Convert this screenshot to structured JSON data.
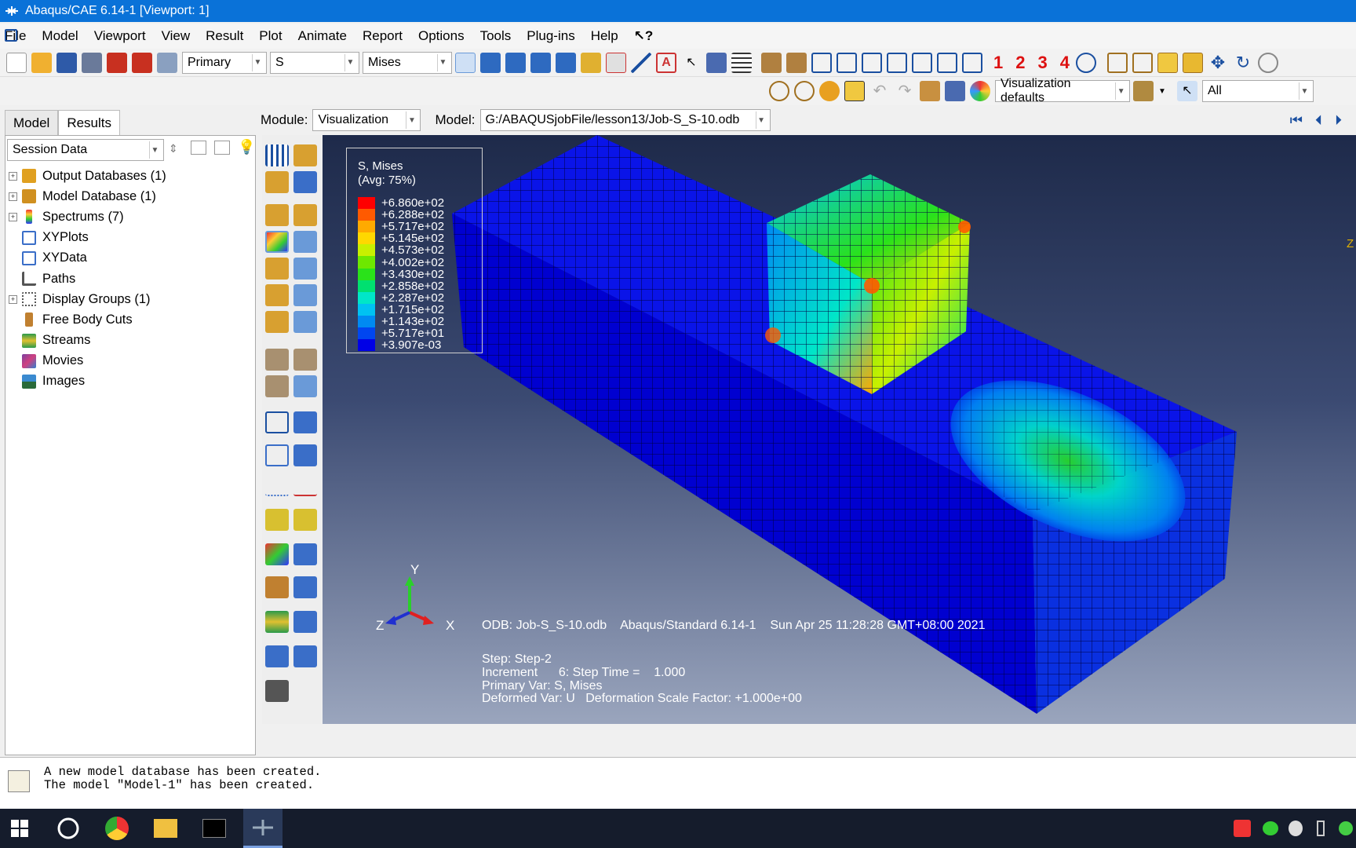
{
  "window": {
    "title": "Abaqus/CAE 6.14-1 [Viewport: 1]"
  },
  "menu": [
    "File",
    "Model",
    "Viewport",
    "View",
    "Result",
    "Plot",
    "Animate",
    "Report",
    "Options",
    "Tools",
    "Plug-ins",
    "Help"
  ],
  "toolbar": {
    "step_combo": "Primary",
    "field_combo": "S",
    "invariant_combo": "Mises",
    "view_numbers": [
      "1",
      "2",
      "3",
      "4"
    ],
    "vis_defaults": "Visualization defaults",
    "selection_filter": "All"
  },
  "modulebar": {
    "module_label": "Module:",
    "module_value": "Visualization",
    "model_label": "Model:",
    "model_value": "G:/ABAQUSjobFile/lesson13/Job-S_S-10.odb"
  },
  "tabs": [
    "Model",
    "Results"
  ],
  "session_combo": "Session Data",
  "tree": [
    {
      "label": "Output Databases (1)",
      "expandable": true,
      "color": "#e0a020"
    },
    {
      "label": "Model Database (1)",
      "expandable": true,
      "color": "#d09020"
    },
    {
      "label": "Spectrums (7)",
      "expandable": true,
      "color": "#e03020"
    },
    {
      "label": "XYPlots",
      "expandable": false,
      "color": "#3a6ec8"
    },
    {
      "label": "XYData",
      "expandable": false,
      "color": "#3a6ec8"
    },
    {
      "label": "Paths",
      "expandable": false,
      "color": "#555555"
    },
    {
      "label": "Display Groups (1)",
      "expandable": true,
      "color": "#666666"
    },
    {
      "label": "Free Body Cuts",
      "expandable": false,
      "color": "#c08030"
    },
    {
      "label": "Streams",
      "expandable": false,
      "color": "#2a9a4a"
    },
    {
      "label": "Movies",
      "expandable": false,
      "color": "#7a40a0"
    },
    {
      "label": "Images",
      "expandable": false,
      "color": "#2a6a9a"
    }
  ],
  "legend": {
    "title": "S, Mises",
    "subtitle": "(Avg: 75%)",
    "values": [
      "+6.860e+02",
      "+6.288e+02",
      "+5.717e+02",
      "+5.145e+02",
      "+4.573e+02",
      "+4.002e+02",
      "+3.430e+02",
      "+2.858e+02",
      "+2.287e+02",
      "+1.715e+02",
      "+1.143e+02",
      "+5.717e+01",
      "+3.907e-03"
    ],
    "colors": [
      "#ff0000",
      "#ff5a00",
      "#ffaa00",
      "#ffd800",
      "#c8f000",
      "#6ee800",
      "#2ae21a",
      "#00e070",
      "#00e6c8",
      "#00c2f2",
      "#008af2",
      "#0046f0",
      "#0000e6"
    ]
  },
  "triad": {
    "y": "Y",
    "z": "Z",
    "x": "X"
  },
  "viewport_info": {
    "odb_line": "ODB: Job-S_S-10.odb    Abaqus/Standard 6.14-1    Sun Apr 25 11:28:28 GMT+08:00 2021",
    "step": "Step: Step-2",
    "increment": "Increment      6: Step Time =    1.000",
    "primary_var": "Primary Var: S, Mises",
    "deformed_var": "Deformed Var: U   Deformation Scale Factor: +1.000e+00",
    "edge_label": "Z"
  },
  "messages": "A new model database has been created.\nThe model \"Model-1\" has been created."
}
